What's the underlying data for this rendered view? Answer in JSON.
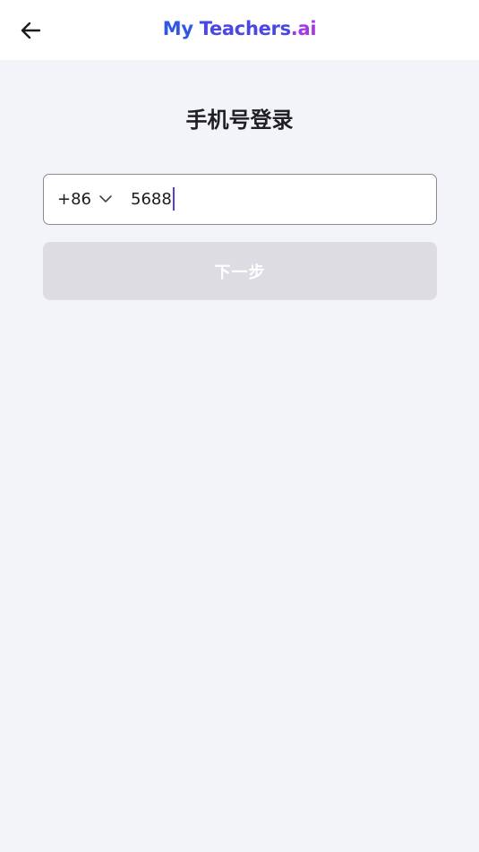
{
  "header": {
    "logo_part1": "My ",
    "logo_part2": "Teachers",
    "logo_part3": ".ai",
    "back_icon": "arrow-left-icon"
  },
  "page": {
    "title": "手机号登录"
  },
  "phone_field": {
    "country_code": "+86",
    "dropdown_icon": "chevron-down-icon",
    "value": "5688"
  },
  "actions": {
    "next_label": "下一步",
    "next_enabled": false
  },
  "colors": {
    "background": "#f2f4f9",
    "logo_blue": "#2f57e6",
    "logo_purple": "#a43ae0",
    "caret": "#5a3fd6",
    "button_disabled": "#dcdce2"
  }
}
